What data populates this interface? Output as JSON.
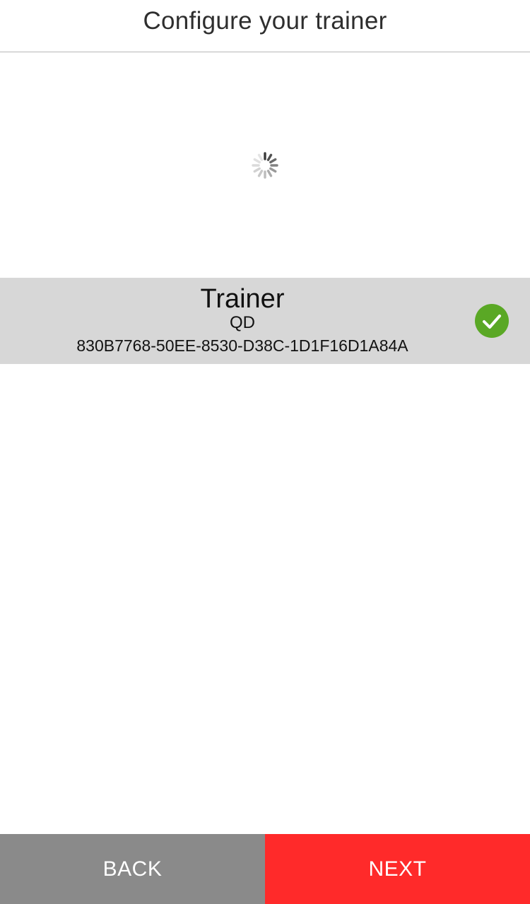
{
  "header": {
    "title": "Configure your trainer"
  },
  "status": {
    "loading_icon": "spinner-icon"
  },
  "devices": [
    {
      "name": "Trainer",
      "type": "QD",
      "id": "830B7768-50EE-8530-D38C-1D1F16D1A84A",
      "selected_icon": "check-circle-icon"
    }
  ],
  "footer": {
    "back_label": "BACK",
    "next_label": "NEXT"
  },
  "colors": {
    "selected_row": "#d7d7d7",
    "check": "#5aa825",
    "back_button": "#8a8a8a",
    "next_button": "#ff2a2a"
  }
}
